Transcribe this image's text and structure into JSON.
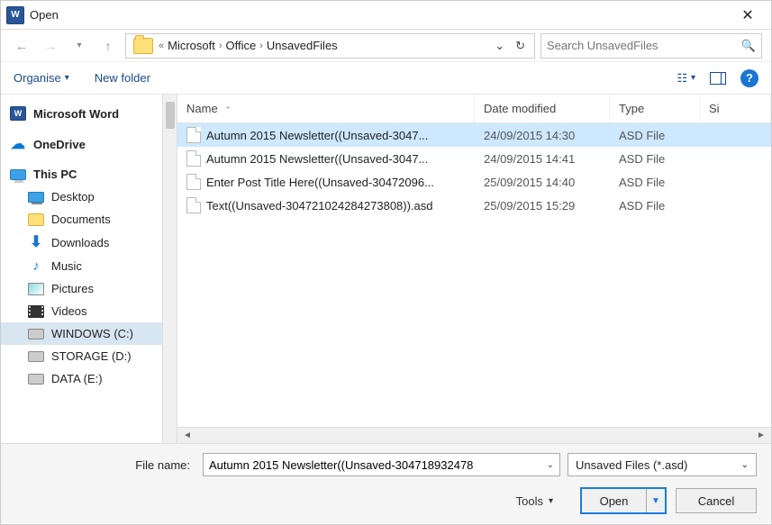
{
  "window": {
    "title": "Open"
  },
  "breadcrumb": {
    "prefix": "«",
    "parts": [
      "Microsoft",
      "Office",
      "UnsavedFiles"
    ]
  },
  "search": {
    "placeholder": "Search UnsavedFiles"
  },
  "toolbar": {
    "organise": "Organise",
    "newfolder": "New folder"
  },
  "sidebar": {
    "items": [
      {
        "label": "Microsoft Word",
        "icon": "word",
        "bold": true
      },
      {
        "label": "OneDrive",
        "icon": "onedrive",
        "bold": true
      },
      {
        "label": "This PC",
        "icon": "thispc",
        "bold": true
      },
      {
        "label": "Desktop",
        "icon": "desktop",
        "indent": true
      },
      {
        "label": "Documents",
        "icon": "folder",
        "indent": true
      },
      {
        "label": "Downloads",
        "icon": "download",
        "indent": true
      },
      {
        "label": "Music",
        "icon": "music",
        "indent": true
      },
      {
        "label": "Pictures",
        "icon": "pictures",
        "indent": true
      },
      {
        "label": "Videos",
        "icon": "videos",
        "indent": true
      },
      {
        "label": "WINDOWS (C:)",
        "icon": "drive",
        "indent": true,
        "selected": true
      },
      {
        "label": "STORAGE (D:)",
        "icon": "drive",
        "indent": true
      },
      {
        "label": "DATA (E:)",
        "icon": "drive",
        "indent": true
      }
    ]
  },
  "columns": {
    "name": "Name",
    "date": "Date modified",
    "type": "Type",
    "size": "Si"
  },
  "files": [
    {
      "name": "Autumn 2015 Newsletter((Unsaved-3047...",
      "date": "24/09/2015 14:30",
      "type": "ASD File",
      "selected": true
    },
    {
      "name": "Autumn 2015 Newsletter((Unsaved-3047...",
      "date": "24/09/2015 14:41",
      "type": "ASD File"
    },
    {
      "name": "Enter Post Title Here((Unsaved-30472096...",
      "date": "25/09/2015 14:40",
      "type": "ASD File"
    },
    {
      "name": "Text((Unsaved-304721024284273808)).asd",
      "date": "25/09/2015 15:29",
      "type": "ASD File"
    }
  ],
  "footer": {
    "filename_label": "File name:",
    "filename_value": "Autumn 2015 Newsletter((Unsaved-304718932478",
    "filter": "Unsaved Files (*.asd)",
    "tools": "Tools",
    "open": "Open",
    "cancel": "Cancel"
  }
}
